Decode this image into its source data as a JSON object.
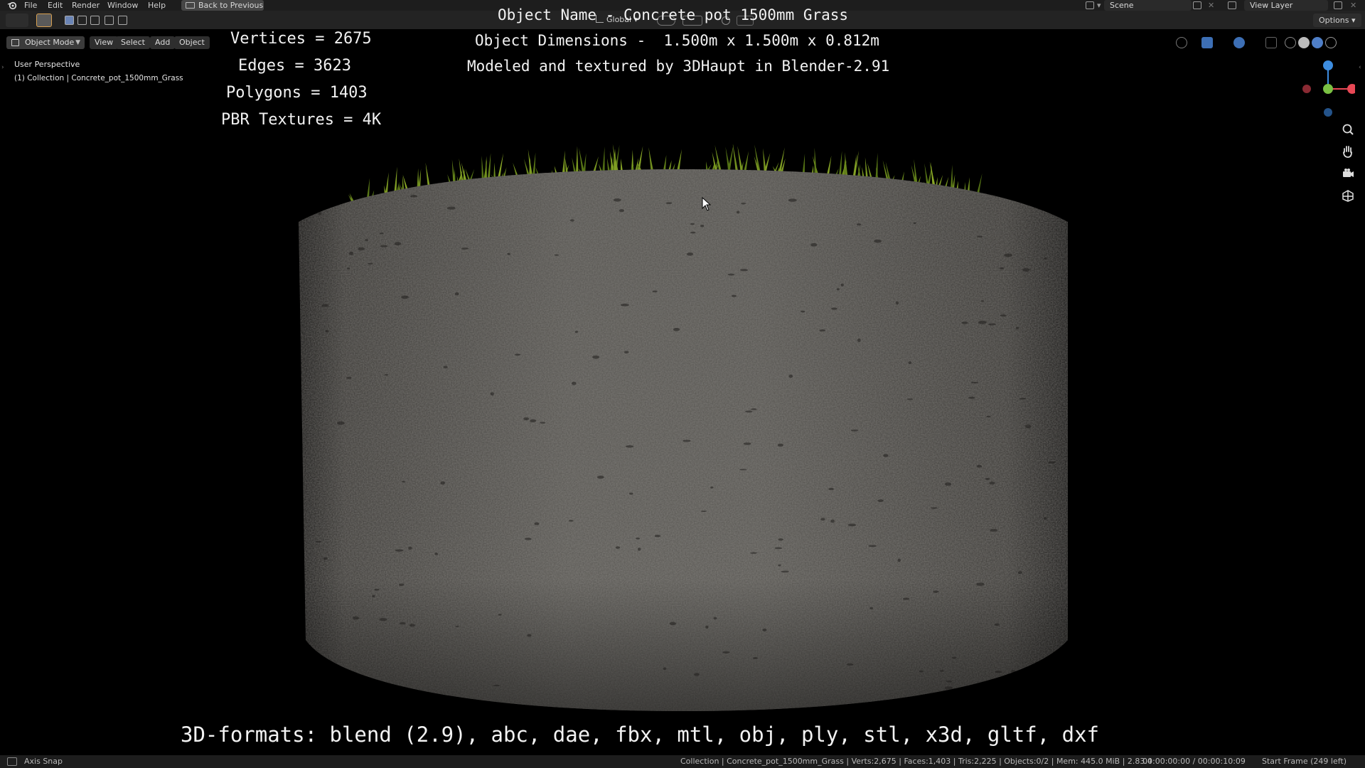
{
  "menubar": {
    "items": [
      "File",
      "Edit",
      "Render",
      "Window",
      "Help"
    ],
    "back_button": "Back to Previous",
    "scene": "Scene",
    "view_layer": "View Layer"
  },
  "toolheader": {
    "orientation": "Global",
    "options": "Options"
  },
  "viewport_header": {
    "mode": "Object Mode",
    "menus": [
      "View",
      "Select",
      "Add",
      "Object"
    ]
  },
  "viewport_info": {
    "perspective": "User Perspective",
    "collection": "(1) Collection | Concrete_pot_1500mm_Grass"
  },
  "overlay": {
    "object_name": "Object Name - Concrete pot 1500mm Grass",
    "dimensions": "Object Dimensions -  1.500m x 1.500m x 0.812m",
    "credits": "Modeled and textured by 3DHaupt in Blender-2.91",
    "vertices": "Vertices = 2675",
    "edges": "Edges = 3623",
    "polygons": "Polygons = 1403",
    "textures": "PBR Textures = 4K",
    "formats": "3D-formats: blend (2.9), abc, dae, fbx, mtl, obj, ply, stl, x3d, gltf, dxf"
  },
  "statusbar": {
    "left": "Axis Snap",
    "stats": "Collection | Concrete_pot_1500mm_Grass | Verts:2,675 | Faces:1,403 | Tris:2,225 | Objects:0/2 | Mem: 445.0 MiB | 2.83.4",
    "time": "00:00:00:00 / 00:00:10:09",
    "frame": "Start Frame (249 left)"
  },
  "colors": {
    "menubar": "#1d1d1d",
    "header": "#232323",
    "viewport": "#000000",
    "concrete": "#5a5753",
    "grass": "#6b7a2a",
    "axis_x": "#e84855",
    "axis_y": "#7ac143",
    "axis_z": "#3d8de0"
  },
  "icons": [
    "blender-logo-icon",
    "select-cursor-icon",
    "box-select-icon",
    "zoom-icon",
    "hand-pan-icon",
    "camera-icon",
    "grid-icon",
    "axis-gizmo",
    "cursor-arrow-icon"
  ]
}
